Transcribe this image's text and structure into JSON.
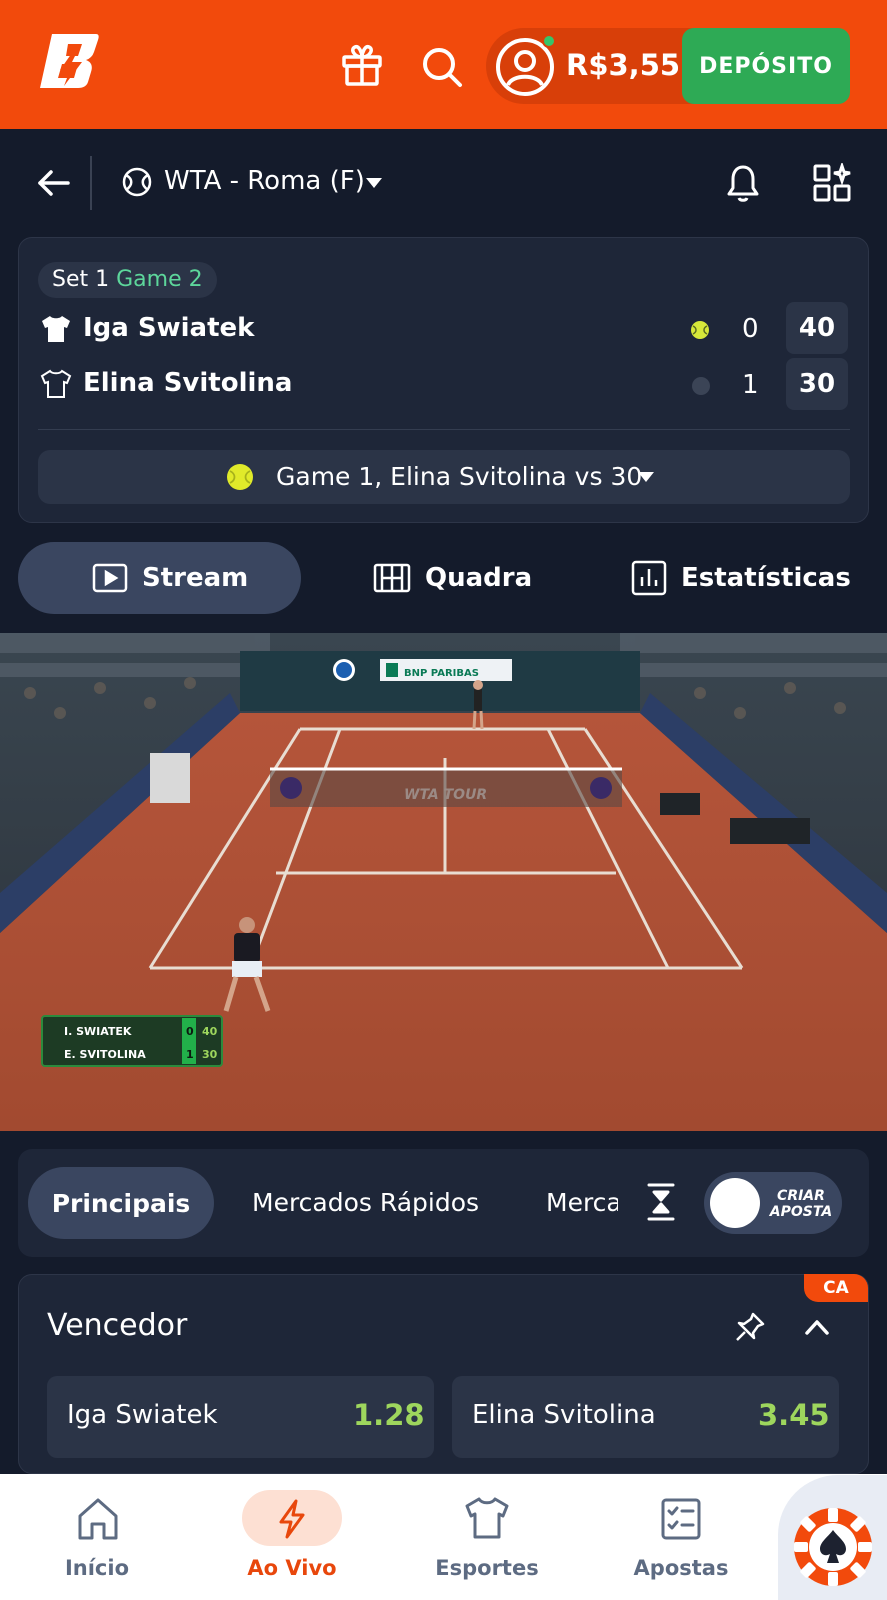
{
  "header": {
    "logo_icon": "brand-b-logo",
    "balance": "R$3,55",
    "deposit_label": "DEPÓSITO",
    "accent": "#f24a0c",
    "deposit_color": "#2eaa55"
  },
  "event": {
    "title": "WTA - Roma (F)"
  },
  "score": {
    "set_label": "Set 1",
    "game_label": "Game 2",
    "players": [
      {
        "name": "Iga Swiatek",
        "sets": "0",
        "points": "40",
        "serving": true
      },
      {
        "name": "Elina Svitolina",
        "sets": "1",
        "points": "30",
        "serving": false
      }
    ],
    "last_point": "Game 1, Elina Svitolina vs 30"
  },
  "tabs": [
    {
      "label": "Stream",
      "active": true,
      "icon": "play-icon"
    },
    {
      "label": "Quadra",
      "active": false,
      "icon": "court-icon"
    },
    {
      "label": "Estatísticas",
      "active": false,
      "icon": "stats-icon"
    }
  ],
  "video": {
    "scoreboard": {
      "p1": "I. SWIATEK",
      "p2": "E. SVITOLINA",
      "p1_sets": "0",
      "p1_pts": "40",
      "p2_sets": "1",
      "p2_pts": "30"
    },
    "banner_text": "BNP PARIBAS",
    "net_text": "WTA TOUR"
  },
  "markets_filter": {
    "chips": [
      "Principais",
      "Mercados Rápidos",
      "Mercados"
    ],
    "toggle_label_line1": "CRIAR",
    "toggle_label_line2": "APOSTA"
  },
  "market": {
    "badge": "CA",
    "title": "Vencedor",
    "odds": [
      {
        "name": "Iga Swiatek",
        "value": "1.28"
      },
      {
        "name": "Elina Svitolina",
        "value": "3.45"
      }
    ]
  },
  "nav": {
    "items": [
      {
        "label": "Início",
        "icon": "home-icon"
      },
      {
        "label": "Ao Vivo",
        "icon": "lightning-icon",
        "active": true
      },
      {
        "label": "Esportes",
        "icon": "jersey-icon"
      },
      {
        "label": "Apostas",
        "icon": "betslip-icon"
      }
    ],
    "casino_icon": "poker-chip-icon"
  }
}
